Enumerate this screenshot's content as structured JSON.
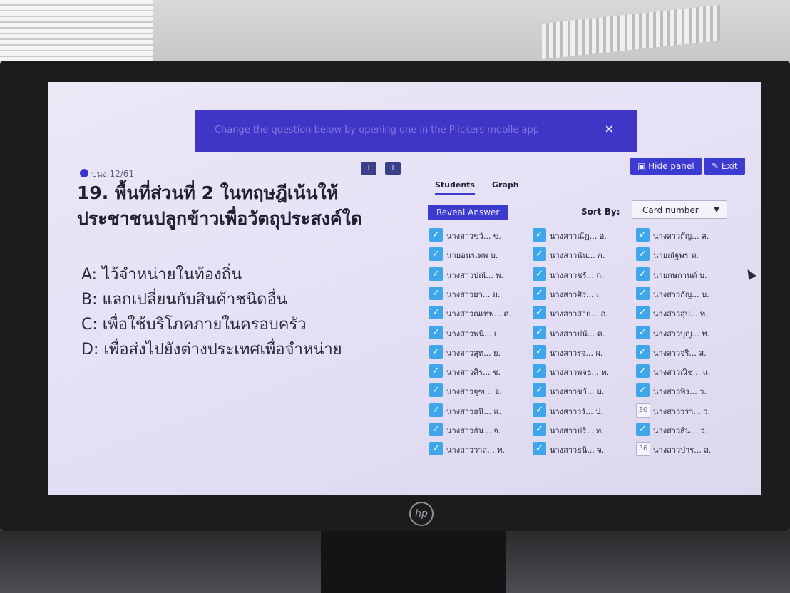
{
  "banner": {
    "text": "Change the question below by opening one in the Plickers mobile app",
    "close": "×"
  },
  "class_name": "ปนง.12/61",
  "text_size_buttons": [
    "T",
    "T"
  ],
  "question": {
    "text": "19. พื้นที่ส่วนที่ 2 ในทฤษฎีเน้นให้ประชาชนปลูกข้าวเพื่อวัตถุประสงค์ใด",
    "answers": [
      "A: ไว้จำหน่ายในท้องถิ่น",
      "B: แลกเปลี่ยนกับสินค้าชนิดอื่น",
      "C: เพื่อใช้บริโภคภายในครอบครัว",
      "D: เพื่อส่งไปยังต่างประเทศเพื่อจำหน่าย"
    ]
  },
  "top_buttons": {
    "hide_panel": "Hide panel",
    "exit": "Exit"
  },
  "panel": {
    "tabs": [
      "Students",
      "Graph"
    ],
    "reveal_answer": "Reveal Answer",
    "sort_by_label": "Sort By:",
    "sort_by_value": "Card number",
    "students": [
      {
        "name": "นางสาวขวั... ข.",
        "status": "check"
      },
      {
        "name": "นางสาวณัฎ... อ.",
        "status": "check"
      },
      {
        "name": "นางสาวกัญ... ส.",
        "status": "check"
      },
      {
        "name": "นายอนรเทพ บ.",
        "status": "check"
      },
      {
        "name": "นางสาวนัน... ก.",
        "status": "check"
      },
      {
        "name": "นายณัฐพร ท.",
        "status": "check"
      },
      {
        "name": "นางสาวปณั... พ.",
        "status": "check"
      },
      {
        "name": "นางสาวชรั... ก.",
        "status": "check"
      },
      {
        "name": "นายกษกานต์ บ.",
        "status": "check"
      },
      {
        "name": "นางสาวยว... ม.",
        "status": "check"
      },
      {
        "name": "นางสาวศิร... เ.",
        "status": "check"
      },
      {
        "name": "นางสาวกัญ... บ.",
        "status": "check"
      },
      {
        "name": "นางสาวณเทพ... ศ.",
        "status": "check"
      },
      {
        "name": "นางสาวสาย... ถ.",
        "status": "check"
      },
      {
        "name": "นางสาวสุป... ท.",
        "status": "check"
      },
      {
        "name": "นางสาวพนิ... เ.",
        "status": "check"
      },
      {
        "name": "นางสาวปนั... ค.",
        "status": "check"
      },
      {
        "name": "นางสาวบุญ... ท.",
        "status": "check"
      },
      {
        "name": "นางสาวสุท... ย.",
        "status": "check"
      },
      {
        "name": "นางสาวรจ... ผ.",
        "status": "check"
      },
      {
        "name": "นางสาวจริ... ส.",
        "status": "check"
      },
      {
        "name": "นางสาวศิร... ช.",
        "status": "check"
      },
      {
        "name": "นางสาวพจธ... ท.",
        "status": "check"
      },
      {
        "name": "นางสาวณิช... แ.",
        "status": "check"
      },
      {
        "name": "นางสาวจุฑ... อ.",
        "status": "check"
      },
      {
        "name": "นางสาวขวั... บ.",
        "status": "check"
      },
      {
        "name": "นางสาวพิร... ว.",
        "status": "check"
      },
      {
        "name": "นางสาวธนิ... แ.",
        "status": "check"
      },
      {
        "name": "นางสาววรั... ป.",
        "status": "check"
      },
      {
        "name": "นางสาววรา... ว.",
        "status": "30"
      },
      {
        "name": "นางสาวธัน... จ.",
        "status": "check"
      },
      {
        "name": "นางสาวปรี... ท.",
        "status": "check"
      },
      {
        "name": "นางสาวสิน... ว.",
        "status": "check"
      },
      {
        "name": "นางสาววาส... พ.",
        "status": "check"
      },
      {
        "name": "นางสาวธนิ... จ.",
        "status": "check"
      },
      {
        "name": "นางสาวปาร... ส.",
        "status": "36"
      }
    ]
  },
  "monitor_brand": "hp",
  "colors": {
    "primary": "#3d3ad0",
    "check": "#3fa6ea",
    "screen_bg": "#e8e4f5"
  }
}
